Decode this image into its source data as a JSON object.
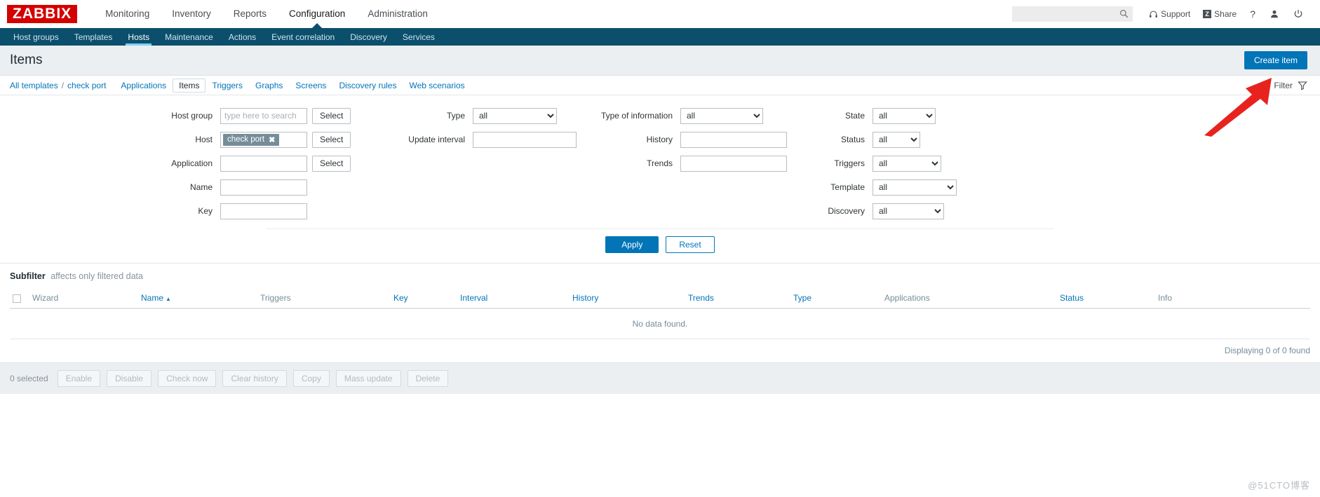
{
  "brand": {
    "logo_text": "ZABBIX",
    "logo_color": "#d40000"
  },
  "header": {
    "nav": [
      {
        "label": "Monitoring",
        "active": false
      },
      {
        "label": "Inventory",
        "active": false
      },
      {
        "label": "Reports",
        "active": false
      },
      {
        "label": "Configuration",
        "active": true
      },
      {
        "label": "Administration",
        "active": false
      }
    ],
    "search": {
      "value": "",
      "placeholder": ""
    },
    "support_label": "Support",
    "share_label": "Share",
    "share_badge": "Z",
    "help_label": "?",
    "icons": [
      "headset-icon",
      "share-icon",
      "help-icon",
      "user-icon",
      "power-icon"
    ]
  },
  "subnav": {
    "items": [
      {
        "label": "Host groups",
        "active": false
      },
      {
        "label": "Templates",
        "active": false
      },
      {
        "label": "Hosts",
        "active": true
      },
      {
        "label": "Maintenance",
        "active": false
      },
      {
        "label": "Actions",
        "active": false
      },
      {
        "label": "Event correlation",
        "active": false
      },
      {
        "label": "Discovery",
        "active": false
      },
      {
        "label": "Services",
        "active": false
      }
    ],
    "accent_color": "#7fd0f5",
    "background_color": "#0b4f6c"
  },
  "page": {
    "title": "Items",
    "create_button": "Create item",
    "accent_color": "#0275b8"
  },
  "breadcrumb": {
    "root": "All templates",
    "separator": "/",
    "current": "check port"
  },
  "tabs": [
    {
      "label": "Applications",
      "active": false
    },
    {
      "label": "Items",
      "active": true
    },
    {
      "label": "Triggers",
      "active": false
    },
    {
      "label": "Graphs",
      "active": false
    },
    {
      "label": "Screens",
      "active": false
    },
    {
      "label": "Discovery rules",
      "active": false
    },
    {
      "label": "Web scenarios",
      "active": false
    }
  ],
  "filter_toggle": {
    "label": "Filter",
    "icon": "funnel-icon"
  },
  "filter": {
    "col1": {
      "host_group": {
        "label": "Host group",
        "value": "",
        "placeholder": "type here to search",
        "select_button": "Select"
      },
      "host": {
        "label": "Host",
        "chip": "check port",
        "chip_remove": "✖",
        "select_button": "Select"
      },
      "application": {
        "label": "Application",
        "value": "",
        "placeholder": "",
        "select_button": "Select"
      },
      "name": {
        "label": "Name",
        "value": "",
        "placeholder": ""
      },
      "key": {
        "label": "Key",
        "value": "",
        "placeholder": ""
      }
    },
    "col2": {
      "type": {
        "label": "Type",
        "value": "all"
      },
      "update_interval": {
        "label": "Update interval",
        "value": "",
        "placeholder": ""
      }
    },
    "col3": {
      "type_of_information": {
        "label": "Type of information",
        "value": "all"
      },
      "history": {
        "label": "History",
        "value": "",
        "placeholder": ""
      },
      "trends": {
        "label": "Trends",
        "value": "",
        "placeholder": ""
      }
    },
    "col4": {
      "state": {
        "label": "State",
        "value": "all"
      },
      "status": {
        "label": "Status",
        "value": "all"
      },
      "triggers": {
        "label": "Triggers",
        "value": "all"
      },
      "template": {
        "label": "Template",
        "value": "all"
      },
      "discovery": {
        "label": "Discovery",
        "value": "all"
      }
    },
    "apply_button": "Apply",
    "reset_button": "Reset"
  },
  "subfilter": {
    "title": "Subfilter",
    "note": "affects only filtered data"
  },
  "table": {
    "columns": [
      {
        "label": "Wizard",
        "link": false
      },
      {
        "label": "Name",
        "link": true,
        "sorted": "asc",
        "sort_glyph": "▲"
      },
      {
        "label": "Triggers",
        "link": false
      },
      {
        "label": "Key",
        "link": true
      },
      {
        "label": "Interval",
        "link": true
      },
      {
        "label": "History",
        "link": true
      },
      {
        "label": "Trends",
        "link": true
      },
      {
        "label": "Type",
        "link": true
      },
      {
        "label": "Applications",
        "link": false
      },
      {
        "label": "Status",
        "link": true
      },
      {
        "label": "Info",
        "link": false
      }
    ],
    "empty_message": "No data found.",
    "rows": [],
    "displaying": "Displaying 0 of 0 found"
  },
  "footer": {
    "selected_count": "0 selected",
    "buttons": [
      {
        "label": "Enable",
        "enabled": false
      },
      {
        "label": "Disable",
        "enabled": false
      },
      {
        "label": "Check now",
        "enabled": false
      },
      {
        "label": "Clear history",
        "enabled": false
      },
      {
        "label": "Copy",
        "enabled": false
      },
      {
        "label": "Mass update",
        "enabled": false
      },
      {
        "label": "Delete",
        "enabled": false
      }
    ]
  },
  "annotation": {
    "type": "arrow",
    "color": "#e8231e",
    "points_to": "create-item-button"
  },
  "watermark": {
    "text": "@51CTO博客"
  }
}
